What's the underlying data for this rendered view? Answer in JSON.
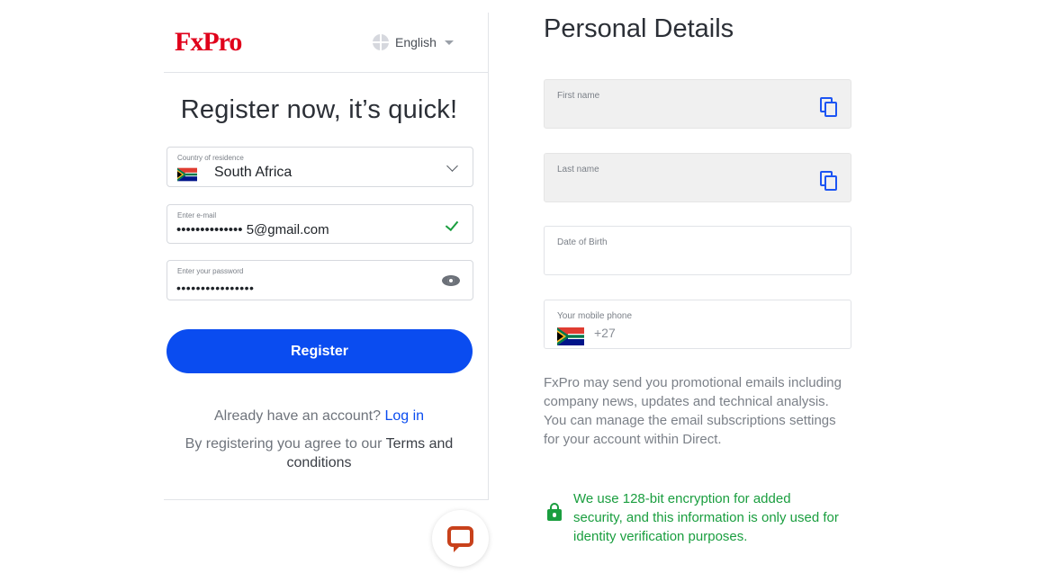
{
  "header": {
    "logo": "FxPro",
    "language": "English",
    "globe_icon": "uk-flag-icon"
  },
  "register": {
    "title": "Register now, it’s quick!",
    "country": {
      "label": "Country of residence",
      "value": "South Africa",
      "flag_icon": "south-africa-flag-icon"
    },
    "email": {
      "label": "Enter e-mail",
      "value": "•••••••••••••• 5@gmail.com",
      "status_icon": "check-icon",
      "status_color": "#1a9e3f"
    },
    "password": {
      "label": "Enter your password",
      "value": "••••••••••••••••",
      "toggle_icon": "eye-icon"
    },
    "submit_label": "Register",
    "submit_color": "#0a4cf0",
    "login_prompt": "Already have an account?",
    "login_link": "Log in",
    "agree_text": "By registering you agree to our",
    "terms_link": "Terms and conditions"
  },
  "personal": {
    "title": "Personal Details",
    "first_name_label": "First name",
    "last_name_label": "Last name",
    "dob_label": "Date of Birth",
    "phone_label": "Your mobile phone",
    "phone_code": "+27",
    "promo_text": "FxPro may send you promotional emails including company news, updates and technical analysis. You can manage the email subscriptions settings for your account within Direct.",
    "security_text": "We use 128-bit encryption for added security, and this information is only used for identity verification purposes.",
    "security_color": "#1a9e3f"
  },
  "chat": {
    "icon": "chat-bubble-icon"
  }
}
